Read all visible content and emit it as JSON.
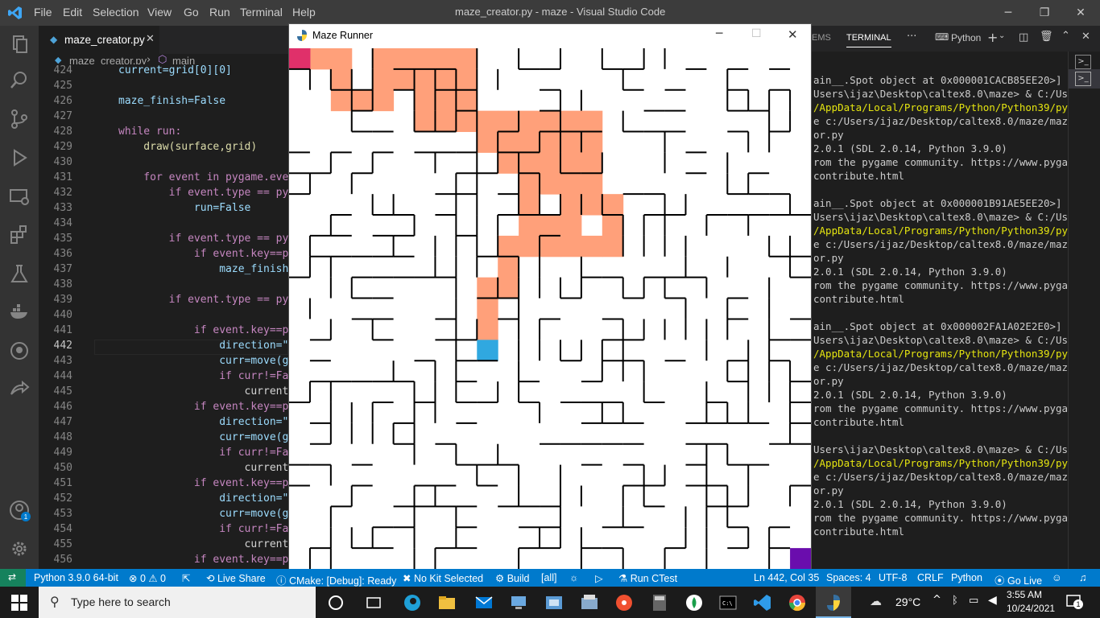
{
  "titlebar": {
    "menus": [
      "File",
      "Edit",
      "Selection",
      "View",
      "Go",
      "Run",
      "Terminal",
      "Help"
    ],
    "title": "maze_creator.py - maze - Visual Studio Code"
  },
  "editor": {
    "tab_label": "maze_creator.py",
    "breadcrumb_file": "maze_creator.py",
    "breadcrumb_symbol": "main",
    "lines": [
      {
        "n": "424",
        "t": "current=grid[0][0]"
      },
      {
        "n": "425",
        "t": ""
      },
      {
        "n": "426",
        "t": "maze_finish=False"
      },
      {
        "n": "427",
        "t": ""
      },
      {
        "n": "428",
        "t": "while run:"
      },
      {
        "n": "429",
        "t": "    draw(surface,grid)"
      },
      {
        "n": "430",
        "t": ""
      },
      {
        "n": "431",
        "t": "    for event in pygame.ever"
      },
      {
        "n": "432",
        "t": "        if event.type == pyg"
      },
      {
        "n": "433",
        "t": "            run=False"
      },
      {
        "n": "434",
        "t": ""
      },
      {
        "n": "435",
        "t": "        if event.type == pyg"
      },
      {
        "n": "436",
        "t": "            if event.key==py"
      },
      {
        "n": "437",
        "t": "                maze_finish="
      },
      {
        "n": "438",
        "t": ""
      },
      {
        "n": "439",
        "t": "        if event.type == pyg"
      },
      {
        "n": "440",
        "t": ""
      },
      {
        "n": "441",
        "t": "            if event.key==py"
      },
      {
        "n": "442",
        "t": "                direction=\""
      },
      {
        "n": "443",
        "t": "                curr=move(gr"
      },
      {
        "n": "444",
        "t": "                if curr!=Fa"
      },
      {
        "n": "445",
        "t": "                    current"
      },
      {
        "n": "446",
        "t": "            if event.key==py"
      },
      {
        "n": "447",
        "t": "                direction=\""
      },
      {
        "n": "448",
        "t": "                curr=move(gr"
      },
      {
        "n": "449",
        "t": "                if curr!=Fa"
      },
      {
        "n": "450",
        "t": "                    current"
      },
      {
        "n": "451",
        "t": "            if event.key==py"
      },
      {
        "n": "452",
        "t": "                direction=\""
      },
      {
        "n": "453",
        "t": "                curr=move(gr"
      },
      {
        "n": "454",
        "t": "                if curr!=Fa"
      },
      {
        "n": "455",
        "t": "                    current"
      },
      {
        "n": "456",
        "t": "            if event.key==py"
      }
    ]
  },
  "panel": {
    "tab_partial": "EMS",
    "tab_terminal": "TERMINAL",
    "more": "···",
    "shell": "Python"
  },
  "terminal": {
    "lines": [
      "ain__.Spot object at 0x000001CACB85EE20>]",
      "Users\\ijaz\\Desktop\\caltex8.0\\maze> & C:/Use",
      "/AppData/Local/Programs/Python/Python39/py",
      "e c:/Users/ijaz/Desktop/caltex8.0/maze/maz",
      "or.py",
      "2.0.1 (SDL 2.0.14, Python 3.9.0)",
      "rom the pygame community. https://www.pyga",
      "contribute.html",
      "",
      "ain__.Spot object at 0x000001B91AE5EE20>]",
      "Users\\ijaz\\Desktop\\caltex8.0\\maze> & C:/Use",
      "/AppData/Local/Programs/Python/Python39/py",
      "e c:/Users/ijaz/Desktop/caltex8.0/maze/maz",
      "or.py",
      "2.0.1 (SDL 2.0.14, Python 3.9.0)",
      "rom the pygame community. https://www.pyga",
      "contribute.html",
      "",
      "ain__.Spot object at 0x000002FA1A02E2E0>]",
      "Users\\ijaz\\Desktop\\caltex8.0\\maze> & C:/Use",
      "/AppData/Local/Programs/Python/Python39/py",
      "e c:/Users/ijaz/Desktop/caltex8.0/maze/maz",
      "or.py",
      "2.0.1 (SDL 2.0.14, Python 3.9.0)",
      "rom the pygame community. https://www.pyga",
      "contribute.html",
      "",
      "Users\\ijaz\\Desktop\\caltex8.0\\maze> & C:/Use",
      "/AppData/Local/Programs/Python/Python39/py",
      "e c:/Users/ijaz/Desktop/caltex8.0/maze/maz",
      "or.py",
      "2.0.1 (SDL 2.0.14, Python 3.9.0)",
      "rom the pygame community. https://www.pyga",
      "contribute.html"
    ]
  },
  "maze": {
    "window_title": "Maze Runner",
    "cols": 25,
    "rows": 25,
    "colors": {
      "path": "#ffa07a",
      "start": "#e0306a",
      "current": "#30a8e0",
      "end": "#6a0dad",
      "wall": "#000000"
    },
    "path_cells": [
      [
        1,
        0
      ],
      [
        2,
        0
      ],
      [
        2,
        1
      ],
      [
        2,
        2
      ],
      [
        3,
        2
      ],
      [
        4,
        2
      ],
      [
        4,
        1
      ],
      [
        4,
        0
      ],
      [
        5,
        0
      ],
      [
        6,
        0
      ],
      [
        7,
        0
      ],
      [
        8,
        0
      ],
      [
        8,
        1
      ],
      [
        8,
        2
      ],
      [
        8,
        3
      ],
      [
        7,
        3
      ],
      [
        6,
        3
      ],
      [
        6,
        2
      ],
      [
        7,
        2
      ],
      [
        7,
        1
      ],
      [
        6,
        1
      ],
      [
        5,
        1
      ],
      [
        9,
        3
      ],
      [
        9,
        4
      ],
      [
        10,
        4
      ],
      [
        10,
        3
      ],
      [
        10,
        5
      ],
      [
        11,
        4
      ],
      [
        11,
        5
      ],
      [
        12,
        5
      ],
      [
        13,
        5
      ],
      [
        14,
        5
      ],
      [
        14,
        6
      ],
      [
        14,
        7
      ],
      [
        15,
        7
      ],
      [
        15,
        8
      ],
      [
        15,
        9
      ],
      [
        14,
        9
      ],
      [
        13,
        9
      ],
      [
        12,
        9
      ],
      [
        12,
        8
      ],
      [
        13,
        8
      ],
      [
        13,
        7
      ],
      [
        13,
        6
      ],
      [
        12,
        6
      ],
      [
        11,
        6
      ],
      [
        11,
        7
      ],
      [
        11,
        8
      ],
      [
        11,
        9
      ],
      [
        10,
        9
      ],
      [
        10,
        10
      ],
      [
        10,
        11
      ],
      [
        9,
        11
      ],
      [
        9,
        12
      ],
      [
        9,
        13
      ],
      [
        12,
        3
      ],
      [
        13,
        3
      ],
      [
        14,
        3
      ],
      [
        14,
        4
      ],
      [
        13,
        4
      ],
      [
        12,
        4
      ],
      [
        11,
        3
      ]
    ],
    "start_cell": [
      0,
      0
    ],
    "current_cell": [
      9,
      14
    ],
    "end_cell": [
      24,
      24
    ]
  },
  "statusbar": {
    "python": "Python 3.9.0 64-bit",
    "errors": "⊗ 0 ⚠ 0",
    "liveshare": "Live Share",
    "cmake": "CMake: [Debug]: Ready",
    "kit": "No Kit Selected",
    "build": "Build",
    "all": "[all]",
    "ctest": "Run CTest",
    "position": "Ln 442, Col 35",
    "spaces": "Spaces: 4",
    "encoding": "UTF-8",
    "eol": "CRLF",
    "language": "Python",
    "golive": "Go Live"
  },
  "taskbar": {
    "search_placeholder": "Type here to search",
    "temperature": "29°C",
    "time": "3:55 AM",
    "date": "10/24/2021",
    "notifications": "1"
  }
}
